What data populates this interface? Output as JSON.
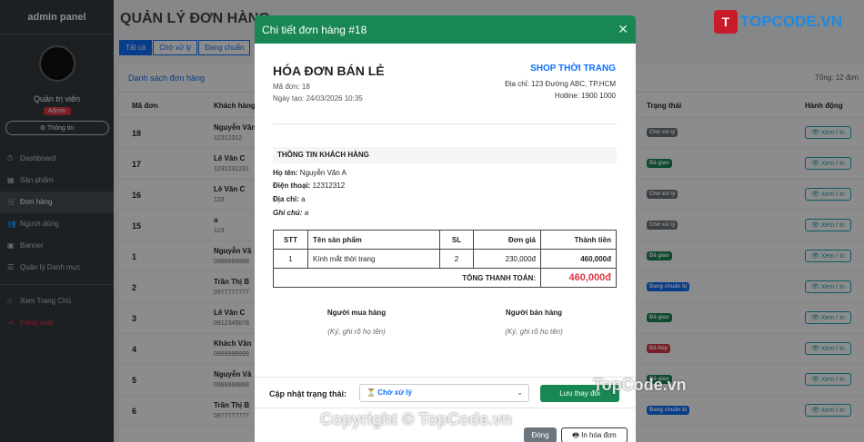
{
  "sidebar": {
    "brand": "admin panel",
    "user_name": "Quản trị viên",
    "role_badge": "Admin",
    "info_button": "Thông tin",
    "items": [
      {
        "label": "Dashboard",
        "icon": "⏱"
      },
      {
        "label": "Sản phẩm",
        "icon": "▦"
      },
      {
        "label": "Đơn hàng",
        "icon": "🛒"
      },
      {
        "label": "Người dùng",
        "icon": "👥"
      },
      {
        "label": "Banner",
        "icon": "▣"
      },
      {
        "label": "Quản lý Danh mục",
        "icon": "☰"
      }
    ],
    "home_link": "Xem Trang Chủ",
    "logout": "Đăng xuất"
  },
  "main": {
    "page_title": "QUẢN LÝ ĐƠN HÀNG",
    "tabs": [
      "Tất cả",
      "Chờ xử lý",
      "Đang chuẩn"
    ],
    "card_title": "Danh sách đơn hàng",
    "total": "Tổng: 12 đơn",
    "columns": {
      "id": "Mã đơn",
      "customer": "Khách hàng",
      "status": "Trạng thái",
      "action": "Hành động"
    },
    "rows": [
      {
        "id": "18",
        "name": "Nguyễn Văn",
        "phone": "12312312",
        "status": "Chờ xử lý",
        "status_color": "#6c757d"
      },
      {
        "id": "17",
        "name": "Lê Văn C",
        "phone": "1231231231",
        "status": "Đã giao",
        "status_color": "#198754"
      },
      {
        "id": "16",
        "name": "Lê Văn C",
        "phone": "123",
        "status": "Chờ xử lý",
        "status_color": "#6c757d"
      },
      {
        "id": "15",
        "name": "a",
        "phone": "123",
        "status": "Chờ xử lý",
        "status_color": "#6c757d"
      },
      {
        "id": "1",
        "name": "Nguyễn Vă",
        "phone": "0988888888",
        "status": "Đã giao",
        "status_color": "#198754"
      },
      {
        "id": "2",
        "name": "Trần Thị B",
        "phone": "0977777777",
        "status": "Đang chuẩn bị",
        "status_color": "#0d6efd"
      },
      {
        "id": "3",
        "name": "Lê Văn C",
        "phone": "0912345678",
        "status": "Đã giao",
        "status_color": "#198754"
      },
      {
        "id": "4",
        "name": "Khách Vãn",
        "phone": "0999999999",
        "status": "Đã hủy",
        "status_color": "#dc3545"
      },
      {
        "id": "5",
        "name": "Nguyễn Vă",
        "phone": "0988888888",
        "status": "Đã giao",
        "status_color": "#198754"
      },
      {
        "id": "6",
        "name": "Trần Thị B",
        "phone": "0977777777",
        "status": "Đang chuẩn bị",
        "status_color": "#0d6efd"
      }
    ],
    "view_button": "Xem / In"
  },
  "modal": {
    "title": "Chi tiết đơn hàng #18",
    "invoice_title": "HÓA ĐƠN BÁN LẺ",
    "order_code": "Mã đơn: 18",
    "created": "Ngày tạo: 24/03/2026 10:35",
    "shop_name": "SHOP THỜI TRANG",
    "shop_address": "Địa chỉ: 123 Đường ABC, TP.HCM",
    "hotline": "Hotline: 1900 1000",
    "customer_section": "THÔNG TIN KHÁCH HÀNG",
    "customer": {
      "name_label": "Họ tên:",
      "name": "Nguyễn Văn A",
      "phone_label": "Điện thoại:",
      "phone": "12312312",
      "address_label": "Địa chỉ:",
      "address": "a",
      "note_label": "Ghi chú:",
      "note": "a"
    },
    "items_table": {
      "headers": [
        "STT",
        "Tên sản phẩm",
        "SL",
        "Đơn giá",
        "Thành tiền"
      ],
      "rows": [
        [
          "1",
          "Kính mắt thời trang",
          "2",
          "230,000đ",
          "460,000đ"
        ]
      ],
      "total_label": "TỔNG THANH TOÁN:",
      "total_value": "460,000đ"
    },
    "buyer_label": "Người mua hàng",
    "buyer_sign": "(Ký, ghi rõ họ tên)",
    "seller_label": "Người bán hàng",
    "seller_sign": "(Ký, ghi rõ họ tên)",
    "update_label": "Cập nhật trạng thái:",
    "status_select": "⏳ Chờ xử lý",
    "save_button": "Lưu thay đổi",
    "close_button": "Đóng",
    "print_button": "In hóa đơn"
  },
  "logo": {
    "mark": "T",
    "text": "TOPCODE.VN"
  },
  "watermarks": [
    "TopCode.vn",
    "Copyright © TopCode.vn"
  ]
}
